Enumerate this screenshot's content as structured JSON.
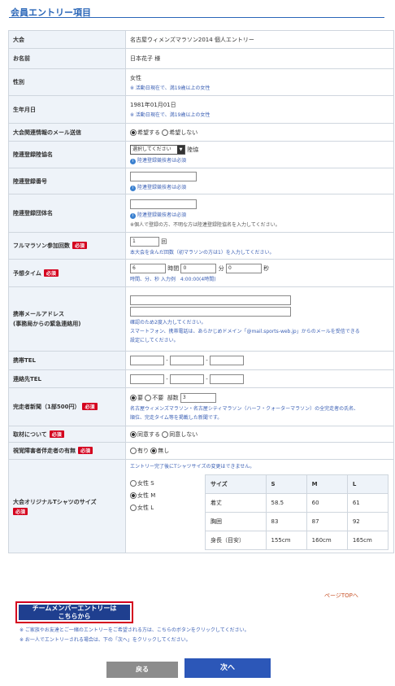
{
  "page": {
    "title": "会員エントリー項目"
  },
  "rows": {
    "event": {
      "label": "大会",
      "value": "名古屋ウィメンズマラソン2014 個人エントリー"
    },
    "name": {
      "label": "お名前",
      "value": "日本花子 様"
    },
    "gender": {
      "label": "性別",
      "value": "女性",
      "note": "※ 活動日現在で、満19歳以上の女性"
    },
    "birth": {
      "label": "生年月日",
      "value": "1981年01月01日",
      "note": "※ 活動日現在で、満19歳以上の女性"
    },
    "mail": {
      "label": "大会関連情報のメール送信",
      "opt1": "希望する",
      "opt2": "希望しない"
    },
    "assoc_name": {
      "label": "陸連登録陸協名",
      "select": "選択してください",
      "suffix": "陸協",
      "note": "陸連登録競技者は必須"
    },
    "assoc_no": {
      "label": "陸連登録番号",
      "note": "陸連登録競技者は必須"
    },
    "assoc_team": {
      "label": "陸連登録団体名",
      "note": "陸連登録競技者は必須",
      "note2": "※個人で登録の方、不明な方は陸連登録陸協名を入力してください。"
    },
    "full_count": {
      "label": "フルマラソン参加回数",
      "req": "必須",
      "value": "1",
      "unit": "回",
      "note": "本大会を含んだ回数（初マラソンの方は1）を入力してください。"
    },
    "time": {
      "label": "予想タイム",
      "req": "必須",
      "h": "6",
      "hu": "時間",
      "m": "0",
      "mu": "分",
      "s": "0",
      "su": "秒",
      "note": "時間、分、秒 入力例　4:00:00(4時間)"
    },
    "mobile_mail": {
      "label": "携帯メールアドレス",
      "label2": "(事務局からの緊急連絡用)",
      "note1": "確認のため2度入力してください。",
      "note2": "スマートフォン、携帯電話は、あらかじめドメイン「@mail.sports-web.jp」からのメールを受信できる",
      "note3": "設定にしてください。"
    },
    "mobile_tel": {
      "label": "携帯TEL",
      "dash": "-"
    },
    "contact_tel": {
      "label": "連絡先TEL",
      "dash": "-"
    },
    "newspaper": {
      "label": "完走者新聞（1部500円）",
      "req": "必須",
      "opt1": "要",
      "opt2": "不要",
      "copies_label": "部数",
      "copies": "3",
      "note1": "名古屋ウィメンズマラソン・名古屋シティマラソン（ハーフ・クォーターマラソン）の全完走者の氏名、",
      "note2": "順位、完走タイム等を掲載した新聞です。"
    },
    "interview": {
      "label": "取材について",
      "req": "必須",
      "opt1": "同意する",
      "opt2": "同意しない"
    },
    "visual": {
      "label": "視覚障害者伴走者の有無",
      "req": "必須",
      "opt1": "有り",
      "opt2": "無し"
    },
    "tshirt": {
      "label": "大会オリジナルTシャツのサイズ",
      "req": "必須",
      "note": "エントリー完了後にTシャツサイズの変更はできません。",
      "options": [
        "女性 S",
        "女性 M",
        "女性 L"
      ],
      "table_head": [
        "サイズ",
        "S",
        "M",
        "L"
      ],
      "table_rows": [
        [
          "着丈",
          "58.5",
          "60",
          "61"
        ],
        [
          "胸囲",
          "83",
          "87",
          "92"
        ],
        [
          "身長（目安）",
          "155cm",
          "160cm",
          "165cm"
        ]
      ]
    }
  },
  "footer": {
    "pagetop": "ページTOPへ",
    "team_line1": "チームメンバーエントリーは",
    "team_line2": "こちらから",
    "note1": "※ ご家族やお友達とご一緒のエントリーをご希望される方は、こちらのボタンをクリックしてください。",
    "note2": "※ お一人でエントリーされる場合は、下の「次へ」をクリックしてください。",
    "back": "戻る",
    "next": "次へ"
  }
}
